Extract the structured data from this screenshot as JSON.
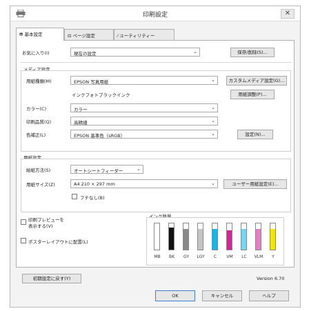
{
  "window": {
    "title": "印刷設定"
  },
  "tabs": [
    {
      "label": "基本設定"
    },
    {
      "label": "ページ設定"
    },
    {
      "label": "ユーティリティー"
    }
  ],
  "favorites": {
    "label": "お気に入り(I)",
    "value": "現在の設定",
    "button": "保存/削除(S)..."
  },
  "media_section": {
    "title": "メディア設定",
    "paper_type_label": "用紙種類(M)",
    "paper_type_value": "EPSON 写真用紙",
    "custom_media_button": "カスタムメディア設定(G)...",
    "ink_note": "インクフォトブラックインク",
    "paper_adjust_button": "用紙調整(P)..."
  },
  "color": {
    "label": "カラー(C)",
    "value": "カラー"
  },
  "quality": {
    "label": "印刷品質(Q)",
    "value": "高精細"
  },
  "color_correction": {
    "label": "色補正(L)",
    "value": "EPSON 基準色（sRGB）",
    "button": "設定(N)..."
  },
  "paper_section": {
    "title": "用紙設定",
    "feed_label": "給紙方法(S)",
    "feed_value": "オートシートフィーダー",
    "size_label": "用紙サイズ(Z)",
    "size_value": "A4 210 × 297 mm",
    "user_size_button": "ユーザー用紙設定(E)...",
    "borderless_label": "フチなし(B)"
  },
  "options": {
    "preview_label_line1": "印刷プレビューを",
    "preview_label_line2": "表示する(V)",
    "poster_label": "ポスターレイアウトに配置(L)"
  },
  "ink_levels": {
    "title": "インク残量",
    "inks": [
      {
        "name": "MB",
        "color": "#ffffff",
        "level": 0.0
      },
      {
        "name": "BK",
        "color": "#111111",
        "level": 0.85
      },
      {
        "name": "GY",
        "color": "#8a8a8a",
        "level": 0.8
      },
      {
        "name": "LGY",
        "color": "#c4c4c4",
        "level": 0.8
      },
      {
        "name": "C",
        "color": "#18b4e8",
        "level": 0.8
      },
      {
        "name": "VM",
        "color": "#e0209a",
        "level": 0.75
      },
      {
        "name": "LC",
        "color": "#78d4f0",
        "level": 0.8
      },
      {
        "name": "VLM",
        "color": "#f078c8",
        "level": 0.8
      },
      {
        "name": "Y",
        "color": "#f2e600",
        "level": 0.8
      }
    ]
  },
  "footer": {
    "reset_button": "初期設定に戻す(Y)",
    "version": "Version 6.70"
  },
  "dialog_buttons": {
    "ok": "OK",
    "cancel": "キャンセル",
    "help": "ヘルプ"
  }
}
